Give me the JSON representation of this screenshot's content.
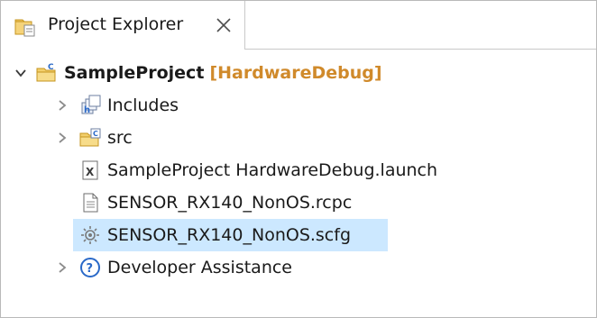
{
  "view": {
    "tab_title": "Project Explorer"
  },
  "tree": {
    "project": {
      "name": "SampleProject",
      "decoration": "[HardwareDebug]"
    },
    "items": [
      {
        "label": "Includes"
      },
      {
        "label": "src"
      },
      {
        "label": "SampleProject HardwareDebug.launch"
      },
      {
        "label": "SENSOR_RX140_NonOS.rcpc"
      },
      {
        "label": "SENSOR_RX140_NonOS.scfg"
      },
      {
        "label": "Developer Assistance"
      }
    ]
  },
  "colors": {
    "selection": "#cce8ff",
    "decoration": "#d08a2b",
    "folder": "#e7c15b",
    "help_blue": "#2a69c8"
  },
  "icons": {
    "tab": "project-explorer-icon",
    "close": "close-icon",
    "project": "project-folder-icon",
    "includes": "includes-icon",
    "src": "source-folder-icon",
    "launch": "launch-file-icon",
    "rcpc": "file-icon",
    "scfg": "gear-file-icon",
    "help": "help-icon"
  },
  "selected_item": "SENSOR_RX140_NonOS.scfg"
}
